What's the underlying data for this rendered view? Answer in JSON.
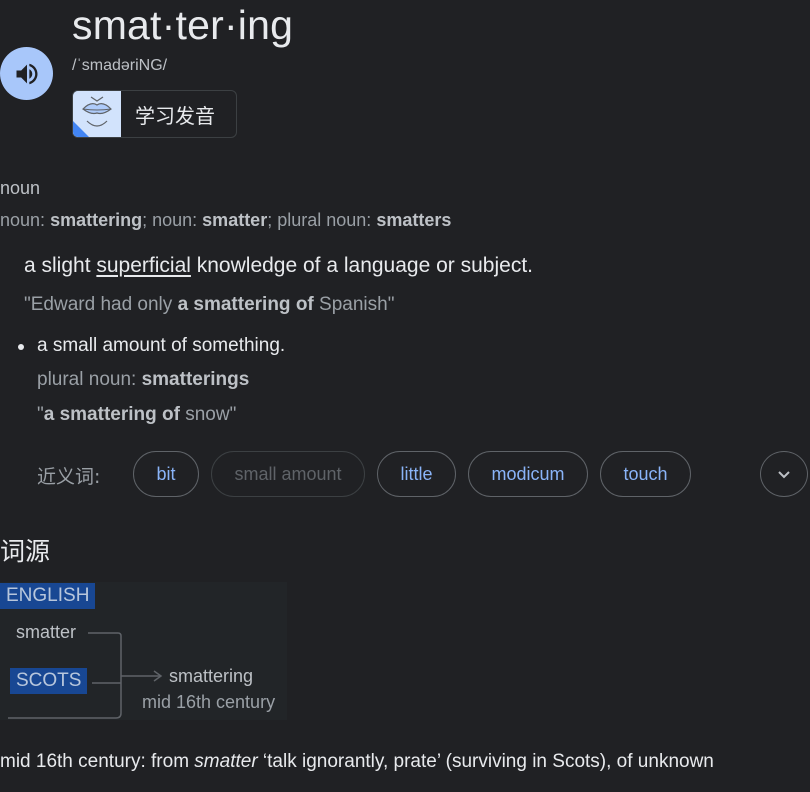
{
  "headword": "smat·ter·ing",
  "phonetic": "/ˈsmadəriNG/",
  "learn_pronunciation": "学习发音",
  "part_of_speech": "noun",
  "forms": [
    {
      "label": "noun",
      "word": "smattering",
      "sep": "; "
    },
    {
      "label": "noun",
      "word": "smatter",
      "sep": "; "
    },
    {
      "label": "plural noun",
      "word": "smatters",
      "sep": ""
    }
  ],
  "definitions": [
    {
      "text_before": "a slight ",
      "link": "superficial",
      "text_after": " knowledge of a language or subject.",
      "example": {
        "open": "\"Edward had only ",
        "bold": "a smattering of",
        "close": " Spanish\""
      }
    },
    {
      "text": "a small amount of something.",
      "form_label": "plural noun",
      "form_word": "smatterings",
      "example": {
        "open": "\"",
        "bold": "a smattering of",
        "close": " snow\""
      }
    }
  ],
  "synonyms_label": "近义词:",
  "synonyms": [
    "bit",
    "small amount",
    "little",
    "modicum",
    "touch"
  ],
  "etymology": {
    "heading": "词源",
    "tags": [
      "ENGLISH",
      "SCOTS"
    ],
    "source_word": "smatter",
    "result_word": "smattering",
    "result_date": "mid 16th century",
    "text_before": "mid 16th century: from ",
    "text_italic": "smatter",
    "text_after": " ‘talk ignorantly, prate’ (surviving in Scots), of unknown"
  },
  "colors": {
    "link": "#8ab4f8",
    "speaker_bg": "#a8c7fa",
    "tag_bg": "#174ea6"
  },
  "icons": [
    "speaker-icon",
    "lips-icon",
    "chevron-down-icon"
  ]
}
